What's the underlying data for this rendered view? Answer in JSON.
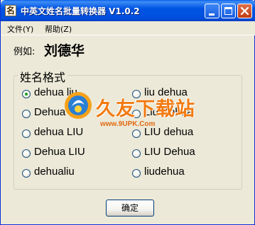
{
  "window": {
    "title": "中英文姓名批量转换器 V1.0.2",
    "icon_char": "名"
  },
  "menu": [
    {
      "label": "文件(Y)"
    },
    {
      "label": "帮助(Z)"
    }
  ],
  "example": {
    "label": "例如:",
    "name": "刘德华"
  },
  "group": {
    "title": "姓名格式",
    "options": [
      {
        "label": "dehua liu",
        "checked": true
      },
      {
        "label": "liu dehua",
        "checked": false
      },
      {
        "label": "Dehua Liu",
        "checked": false
      },
      {
        "label": "Liu Dehua",
        "checked": false
      },
      {
        "label": "dehua LIU",
        "checked": false
      },
      {
        "label": "LIU dehua",
        "checked": false
      },
      {
        "label": "Dehua LIU",
        "checked": false
      },
      {
        "label": "LIU Dehua",
        "checked": false
      },
      {
        "label": "dehualiu",
        "checked": false
      },
      {
        "label": "liudehua",
        "checked": false
      }
    ]
  },
  "ok_button": {
    "label": "确定"
  },
  "watermark": {
    "text": "久友下载站",
    "url": "www.9UPK.Com"
  },
  "colors": {
    "titlebar": "#0054e3",
    "window_bg": "#ece9d8",
    "close_button": "#c13c14",
    "radio_dot": "#1a9a1a",
    "watermark": "#f27a10"
  }
}
